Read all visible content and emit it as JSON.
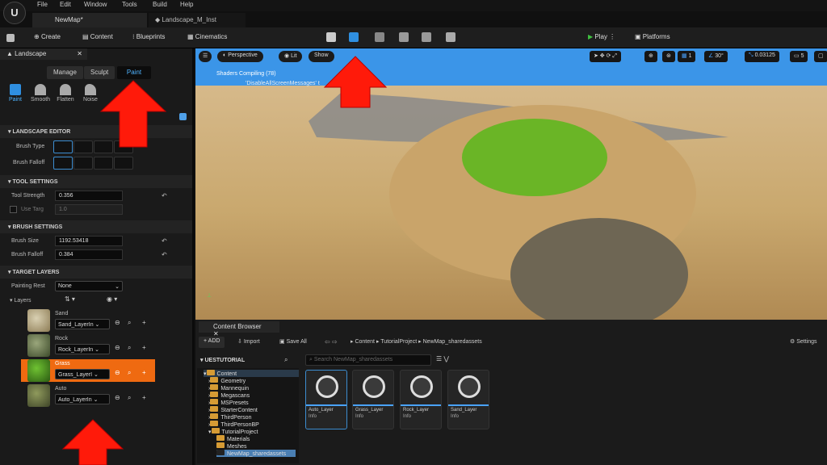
{
  "menu": [
    "File",
    "Edit",
    "Window",
    "Tools",
    "Build",
    "Help"
  ],
  "tabs": [
    "NewMap*",
    "Landscape_M_Inst"
  ],
  "toolbar": {
    "create": "Create",
    "content": "Content",
    "blueprints": "Blueprints",
    "cinematics": "Cinematics",
    "play": "Play",
    "platforms": "Platforms"
  },
  "landscape": {
    "panel_title": "Landscape",
    "modes": [
      "Manage",
      "Sculpt",
      "Paint"
    ],
    "tools": [
      "Paint",
      "Smooth",
      "Flatten",
      "Noise"
    ],
    "landscape_editor": "LANDSCAPE EDITOR",
    "brush_type": "Brush Type",
    "brush_falloff_label": "Brush Falloff",
    "tool_settings": "TOOL SETTINGS",
    "tool_strength": "Tool Strength",
    "tool_strength_value": "0.356",
    "use_target": "Use Targ",
    "use_target_value": "1.0",
    "brush_settings": "BRUSH SETTINGS",
    "brush_size": "Brush Size",
    "brush_size_value": "1192.53418",
    "brush_falloff": "Brush Falloff",
    "brush_falloff_value": "0.384",
    "target_layers": "TARGET LAYERS",
    "painting_restriction": "Painting Rest",
    "painting_restriction_value": "None",
    "layers_label": "Layers",
    "layers": [
      {
        "name": "Sand",
        "info": "Sand_LayerIn"
      },
      {
        "name": "Rock",
        "info": "Rock_LayerIn"
      },
      {
        "name": "Grass",
        "info": "Grass_LayerI"
      },
      {
        "name": "Auto",
        "info": "Auto_LayerIn"
      }
    ]
  },
  "viewport": {
    "perspective": "Perspective",
    "lit": "Lit",
    "show": "Show",
    "status": "Shaders Compiling (78)",
    "status2": "'DisableAllScreenMessages' t",
    "grid": "1",
    "angle": "30°",
    "scale": "0.03125",
    "cam": "5"
  },
  "content_browser": {
    "title": "Content Browser",
    "add": "+ ADD",
    "import": "Import",
    "save_all": "Save All",
    "path": [
      "Content",
      "TutorialProject",
      "NewMap_sharedassets"
    ],
    "settings": "Settings",
    "project": "UESTUTORIAL",
    "search_placeholder": "Search NewMap_sharedassets",
    "tree": [
      "Content",
      "Geometry",
      "Mannequin",
      "Megascans",
      "MSPresets",
      "StarterContent",
      "ThirdPerson",
      "ThirdPersonBP",
      "TutorialProject",
      "Materials",
      "Meshes",
      "NewMap_sharedassets"
    ],
    "assets": [
      {
        "name": "Auto_Layer",
        "kind": "Info"
      },
      {
        "name": "Grass_Layer",
        "kind": "Info"
      },
      {
        "name": "Rock_Layer",
        "kind": "Info"
      },
      {
        "name": "Sand_Layer",
        "kind": "Info"
      }
    ]
  },
  "colors": {
    "accent": "#ef6a11",
    "arrow": "#ff1a0a",
    "select": "#3c8ccf"
  }
}
